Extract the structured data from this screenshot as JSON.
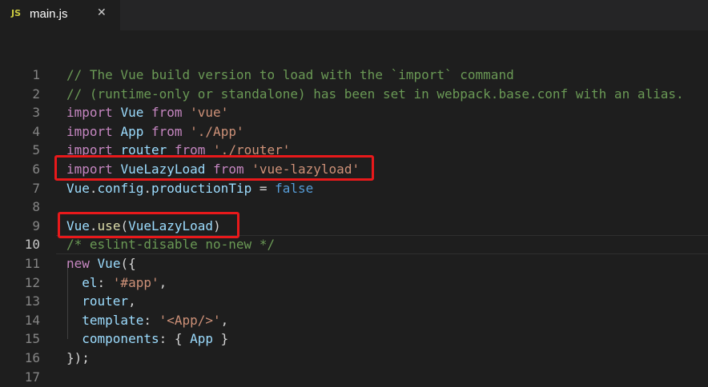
{
  "tab": {
    "icon_label": "JS",
    "filename": "main.js",
    "close_glyph": "✕"
  },
  "editor": {
    "active_line": 10,
    "lines": [
      {
        "n": "1",
        "tokens": [
          [
            "cm",
            "// The Vue build version to load with the `import` command"
          ]
        ]
      },
      {
        "n": "2",
        "tokens": [
          [
            "cm",
            "// (runtime-only or standalone) has been set in webpack.base.conf with an alias."
          ]
        ]
      },
      {
        "n": "3",
        "tokens": [
          [
            "kw",
            "import"
          ],
          [
            "pn",
            " "
          ],
          [
            "id",
            "Vue"
          ],
          [
            "pn",
            " "
          ],
          [
            "kw",
            "from"
          ],
          [
            "pn",
            " "
          ],
          [
            "str",
            "'vue'"
          ]
        ]
      },
      {
        "n": "4",
        "tokens": [
          [
            "kw",
            "import"
          ],
          [
            "pn",
            " "
          ],
          [
            "id",
            "App"
          ],
          [
            "pn",
            " "
          ],
          [
            "kw",
            "from"
          ],
          [
            "pn",
            " "
          ],
          [
            "str",
            "'./App'"
          ]
        ]
      },
      {
        "n": "5",
        "tokens": [
          [
            "kw",
            "import"
          ],
          [
            "pn",
            " "
          ],
          [
            "id",
            "router"
          ],
          [
            "pn",
            " "
          ],
          [
            "kw",
            "from"
          ],
          [
            "pn",
            " "
          ],
          [
            "str",
            "'./router'"
          ]
        ]
      },
      {
        "n": "6",
        "tokens": [
          [
            "kw",
            "import"
          ],
          [
            "pn",
            " "
          ],
          [
            "id",
            "VueLazyLoad"
          ],
          [
            "pn",
            " "
          ],
          [
            "kw",
            "from"
          ],
          [
            "pn",
            " "
          ],
          [
            "str",
            "'vue-lazyload'"
          ]
        ]
      },
      {
        "n": "7",
        "tokens": [
          [
            "id",
            "Vue"
          ],
          [
            "pn",
            "."
          ],
          [
            "id",
            "config"
          ],
          [
            "pn",
            "."
          ],
          [
            "id",
            "productionTip"
          ],
          [
            "pn",
            " = "
          ],
          [
            "bl",
            "false"
          ]
        ]
      },
      {
        "n": "8",
        "tokens": []
      },
      {
        "n": "9",
        "tokens": [
          [
            "id",
            "Vue"
          ],
          [
            "pn",
            "."
          ],
          [
            "fn",
            "use"
          ],
          [
            "pn",
            "("
          ],
          [
            "id",
            "VueLazyLoad"
          ],
          [
            "pn",
            ")"
          ]
        ]
      },
      {
        "n": "10",
        "tokens": [
          [
            "cm",
            "/* eslint-disable no-new */"
          ]
        ]
      },
      {
        "n": "11",
        "tokens": [
          [
            "kw",
            "new"
          ],
          [
            "pn",
            " "
          ],
          [
            "id",
            "Vue"
          ],
          [
            "pn",
            "({"
          ]
        ]
      },
      {
        "n": "12",
        "tokens": [
          [
            "pn",
            "  "
          ],
          [
            "id",
            "el"
          ],
          [
            "pn",
            ": "
          ],
          [
            "str",
            "'#app'"
          ],
          [
            "pn",
            ","
          ]
        ]
      },
      {
        "n": "13",
        "tokens": [
          [
            "pn",
            "  "
          ],
          [
            "id",
            "router"
          ],
          [
            "pn",
            ","
          ]
        ]
      },
      {
        "n": "14",
        "tokens": [
          [
            "pn",
            "  "
          ],
          [
            "id",
            "template"
          ],
          [
            "pn",
            ": "
          ],
          [
            "str",
            "'<App/>'"
          ],
          [
            "pn",
            ","
          ]
        ]
      },
      {
        "n": "15",
        "tokens": [
          [
            "pn",
            "  "
          ],
          [
            "id",
            "components"
          ],
          [
            "pn",
            ": { "
          ],
          [
            "id",
            "App"
          ],
          [
            "pn",
            " }"
          ]
        ]
      },
      {
        "n": "16",
        "tokens": [
          [
            "pn",
            "});"
          ]
        ]
      },
      {
        "n": "17",
        "tokens": []
      }
    ]
  },
  "highlights": [
    {
      "name": "highlight-import-vuelazyload",
      "line": 6
    },
    {
      "name": "highlight-vue-use",
      "line": 9
    }
  ],
  "colors": {
    "highlight_border": "#e8191b",
    "background": "#1e1e1e",
    "comment": "#6a9955",
    "keyword": "#c586c0",
    "identifier": "#9cdcfe",
    "string": "#ce9178"
  }
}
